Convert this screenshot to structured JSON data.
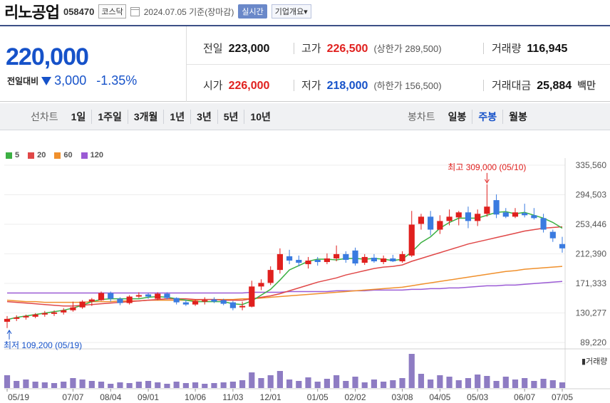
{
  "header": {
    "name": "리노공업",
    "code": "058470",
    "market": "코스닥",
    "date_text": "2024.07.05 기준(장마감)",
    "realtime_label": "실시간",
    "info_label": "기업개요▾"
  },
  "quote": {
    "price": "220,000",
    "change_label": "전일대비",
    "change_value": "3,000",
    "change_pct": "-1.35%",
    "colors": {
      "up": "#e0201e",
      "down": "#1652c9"
    },
    "stats": {
      "prev_close": {
        "label": "전일",
        "value": "223,000"
      },
      "high": {
        "label": "고가",
        "value": "226,500",
        "sub": "(상한가 289,500)"
      },
      "volume": {
        "label": "거래량",
        "value": "116,945"
      },
      "open": {
        "label": "시가",
        "value": "226,000"
      },
      "low": {
        "label": "저가",
        "value": "218,000",
        "sub": "(하한가 156,500)"
      },
      "amount": {
        "label": "거래대금",
        "value": "25,884",
        "unit": "백만"
      }
    }
  },
  "periods": {
    "line_label": "선차트",
    "line_items": [
      "1일",
      "1주일",
      "3개월",
      "1년",
      "3년",
      "5년",
      "10년"
    ],
    "candle_label": "봉차트",
    "candle_items": [
      "일봉",
      "주봉",
      "월봉"
    ],
    "candle_active": "주봉"
  },
  "chart_data": {
    "type": "candlestick",
    "interval": "weekly",
    "legend": [
      {
        "name": "5",
        "color": "#3cb043"
      },
      {
        "name": "20",
        "color": "#e04848"
      },
      {
        "name": "60",
        "color": "#f0902c"
      },
      {
        "name": "120",
        "color": "#9b5bd5"
      }
    ],
    "y_ticks": [
      89220,
      130277,
      171333,
      212390,
      253446,
      294503,
      335560
    ],
    "y_tick_labels": [
      "89,220",
      "130,277",
      "171,333",
      "212,390",
      "253,446",
      "294,503",
      "335,560"
    ],
    "ylim": [
      89220,
      335560
    ],
    "x_ticks": [
      {
        "index": 0,
        "label": "05/19"
      },
      {
        "index": 7,
        "label": "07/07"
      },
      {
        "index": 11,
        "label": "08/04"
      },
      {
        "index": 15,
        "label": "09/01"
      },
      {
        "index": 20,
        "label": "10/06"
      },
      {
        "index": 24,
        "label": "11/03"
      },
      {
        "index": 28,
        "label": "12/01"
      },
      {
        "index": 33,
        "label": "01/05"
      },
      {
        "index": 37,
        "label": "02/02"
      },
      {
        "index": 42,
        "label": "03/08"
      },
      {
        "index": 46,
        "label": "04/05"
      },
      {
        "index": 50,
        "label": "05/03"
      },
      {
        "index": 55,
        "label": "06/07"
      },
      {
        "index": 59,
        "label": "07/05"
      }
    ],
    "annotations": {
      "high": {
        "text": "최고 309,000 (05/10)",
        "index": 51,
        "value": 309000
      },
      "low": {
        "text": "최저 109,200 (05/19)",
        "index": 0,
        "value": 109200
      }
    },
    "volume_label": "▮거래량",
    "candles": [
      {
        "o": 118000,
        "h": 126000,
        "l": 109200,
        "c": 122000
      },
      {
        "o": 122000,
        "h": 127000,
        "l": 119000,
        "c": 124000
      },
      {
        "o": 124000,
        "h": 128000,
        "l": 121000,
        "c": 126000
      },
      {
        "o": 125000,
        "h": 130000,
        "l": 123000,
        "c": 128000
      },
      {
        "o": 128000,
        "h": 133000,
        "l": 125000,
        "c": 130000
      },
      {
        "o": 129000,
        "h": 134000,
        "l": 126000,
        "c": 131000
      },
      {
        "o": 131000,
        "h": 137000,
        "l": 128000,
        "c": 134000
      },
      {
        "o": 134000,
        "h": 146000,
        "l": 132000,
        "c": 138000
      },
      {
        "o": 138000,
        "h": 148000,
        "l": 136000,
        "c": 146000
      },
      {
        "o": 146000,
        "h": 151000,
        "l": 140000,
        "c": 149000
      },
      {
        "o": 148000,
        "h": 160000,
        "l": 147000,
        "c": 158000
      },
      {
        "o": 158000,
        "h": 160000,
        "l": 146000,
        "c": 150000
      },
      {
        "o": 150000,
        "h": 152000,
        "l": 141000,
        "c": 144000
      },
      {
        "o": 144000,
        "h": 155000,
        "l": 142000,
        "c": 153000
      },
      {
        "o": 153000,
        "h": 159000,
        "l": 151000,
        "c": 155000
      },
      {
        "o": 156000,
        "h": 158000,
        "l": 150000,
        "c": 153000
      },
      {
        "o": 150000,
        "h": 159000,
        "l": 148000,
        "c": 157000
      },
      {
        "o": 157000,
        "h": 159000,
        "l": 149000,
        "c": 151000
      },
      {
        "o": 151000,
        "h": 152000,
        "l": 142000,
        "c": 145000
      },
      {
        "o": 145000,
        "h": 149000,
        "l": 140000,
        "c": 142000
      },
      {
        "o": 142000,
        "h": 149000,
        "l": 140000,
        "c": 147000
      },
      {
        "o": 146000,
        "h": 152000,
        "l": 142000,
        "c": 148000
      },
      {
        "o": 149000,
        "h": 152000,
        "l": 144000,
        "c": 146000
      },
      {
        "o": 148000,
        "h": 150000,
        "l": 141000,
        "c": 143000
      },
      {
        "o": 145000,
        "h": 147000,
        "l": 134000,
        "c": 137000
      },
      {
        "o": 138000,
        "h": 146000,
        "l": 134000,
        "c": 140000
      },
      {
        "o": 139000,
        "h": 175000,
        "l": 138000,
        "c": 167000
      },
      {
        "o": 167000,
        "h": 177000,
        "l": 162000,
        "c": 172000
      },
      {
        "o": 172000,
        "h": 195000,
        "l": 169000,
        "c": 190000
      },
      {
        "o": 190000,
        "h": 220000,
        "l": 185000,
        "c": 212000
      },
      {
        "o": 209000,
        "h": 218000,
        "l": 198000,
        "c": 203000
      },
      {
        "o": 204000,
        "h": 210000,
        "l": 195000,
        "c": 200000
      },
      {
        "o": 198000,
        "h": 208000,
        "l": 192000,
        "c": 203000
      },
      {
        "o": 204000,
        "h": 208000,
        "l": 196000,
        "c": 201000
      },
      {
        "o": 201000,
        "h": 213000,
        "l": 198000,
        "c": 206000
      },
      {
        "o": 206000,
        "h": 224000,
        "l": 202000,
        "c": 212000
      },
      {
        "o": 212000,
        "h": 216000,
        "l": 200000,
        "c": 204000
      },
      {
        "o": 217000,
        "h": 221000,
        "l": 196000,
        "c": 199000
      },
      {
        "o": 200000,
        "h": 212000,
        "l": 197000,
        "c": 208000
      },
      {
        "o": 207000,
        "h": 212000,
        "l": 200000,
        "c": 202000
      },
      {
        "o": 201000,
        "h": 210000,
        "l": 198000,
        "c": 206000
      },
      {
        "o": 206000,
        "h": 211000,
        "l": 201000,
        "c": 202000
      },
      {
        "o": 202000,
        "h": 216000,
        "l": 200000,
        "c": 212000
      },
      {
        "o": 210000,
        "h": 272000,
        "l": 208000,
        "c": 253000
      },
      {
        "o": 254000,
        "h": 268000,
        "l": 246000,
        "c": 264000
      },
      {
        "o": 264000,
        "h": 272000,
        "l": 238000,
        "c": 246000
      },
      {
        "o": 246000,
        "h": 266000,
        "l": 240000,
        "c": 258000
      },
      {
        "o": 258000,
        "h": 274000,
        "l": 252000,
        "c": 264000
      },
      {
        "o": 263000,
        "h": 272000,
        "l": 252000,
        "c": 270000
      },
      {
        "o": 270000,
        "h": 278000,
        "l": 248000,
        "c": 258000
      },
      {
        "o": 258000,
        "h": 274000,
        "l": 251000,
        "c": 268000
      },
      {
        "o": 268000,
        "h": 309000,
        "l": 264000,
        "c": 278000
      },
      {
        "o": 287000,
        "h": 295000,
        "l": 262000,
        "c": 267000
      },
      {
        "o": 270000,
        "h": 276000,
        "l": 262000,
        "c": 264000
      },
      {
        "o": 264000,
        "h": 276000,
        "l": 262000,
        "c": 270000
      },
      {
        "o": 269000,
        "h": 282000,
        "l": 263000,
        "c": 266000
      },
      {
        "o": 266000,
        "h": 276000,
        "l": 260000,
        "c": 262000
      },
      {
        "o": 262000,
        "h": 268000,
        "l": 242000,
        "c": 246000
      },
      {
        "o": 243000,
        "h": 246000,
        "l": 229000,
        "c": 234000
      },
      {
        "o": 226000,
        "h": 236000,
        "l": 214000,
        "c": 220000
      }
    ],
    "ma5": [
      121,
      124,
      126,
      128,
      130,
      132,
      134,
      137,
      141,
      146,
      149,
      150,
      150,
      150,
      150,
      152,
      153,
      152,
      150,
      148,
      146,
      146,
      146,
      146,
      143,
      142,
      147,
      155,
      163,
      176,
      190,
      196,
      202,
      205,
      205,
      204,
      206,
      206,
      205,
      206,
      205,
      203,
      205,
      215,
      228,
      236,
      248,
      256,
      262,
      262,
      262,
      266,
      270,
      271,
      268,
      270,
      266,
      262,
      256,
      248
    ],
    "ma20": [
      146,
      145,
      144,
      143,
      142,
      141,
      140,
      140,
      141,
      142,
      143,
      144,
      145,
      146,
      147,
      148,
      149,
      150,
      150,
      150,
      149,
      149,
      149,
      148,
      148,
      148,
      150,
      152,
      154,
      157,
      161,
      165,
      169,
      173,
      176,
      179,
      183,
      186,
      189,
      192,
      194,
      195,
      197,
      202,
      206,
      210,
      214,
      218,
      222,
      226,
      229,
      232,
      235,
      238,
      241,
      244,
      246,
      248,
      249,
      250
    ],
    "ma60": [
      148,
      147,
      146,
      146,
      145,
      145,
      145,
      145,
      145,
      146,
      146,
      146,
      147,
      147,
      147,
      148,
      148,
      148,
      148,
      148,
      148,
      149,
      149,
      149,
      149,
      150,
      150,
      151,
      152,
      153,
      154,
      155,
      156,
      157,
      158,
      159,
      160,
      161,
      162,
      163,
      164,
      165,
      166,
      168,
      170,
      172,
      174,
      176,
      178,
      180,
      182,
      184,
      186,
      188,
      189,
      191,
      192,
      193,
      194,
      195
    ],
    "ma120": [
      158,
      158,
      158,
      158,
      158,
      158,
      158,
      158,
      158,
      158,
      158,
      158,
      158,
      158,
      158,
      158,
      158,
      158,
      158,
      158,
      158,
      158,
      158,
      158,
      158,
      158,
      159,
      159,
      159,
      159,
      160,
      160,
      160,
      160,
      160,
      161,
      161,
      161,
      161,
      162,
      162,
      162,
      162,
      163,
      163,
      164,
      164,
      165,
      165,
      166,
      167,
      168,
      168,
      169,
      169,
      170,
      171,
      172,
      173,
      174
    ],
    "ma_units": "thousand KRW",
    "volume": [
      18,
      10,
      12,
      9,
      8,
      7,
      9,
      14,
      12,
      10,
      9,
      6,
      8,
      7,
      9,
      10,
      8,
      6,
      9,
      7,
      8,
      6,
      7,
      8,
      9,
      11,
      22,
      14,
      18,
      24,
      12,
      10,
      15,
      9,
      13,
      18,
      10,
      16,
      8,
      12,
      9,
      11,
      14,
      48,
      20,
      12,
      18,
      16,
      11,
      14,
      19,
      17,
      10,
      16,
      12,
      14,
      10,
      13,
      11,
      8
    ],
    "volume_units": "relative"
  }
}
